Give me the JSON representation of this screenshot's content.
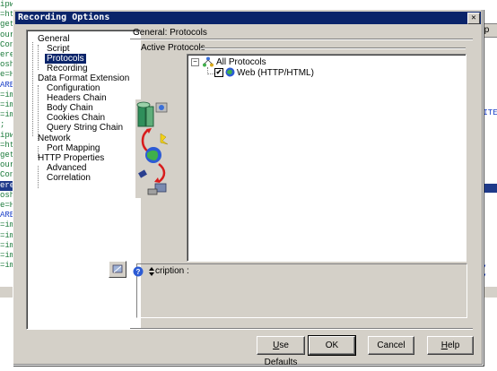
{
  "background": {
    "left_code_lines": [
      "ipw_",
      "=htt",
      "getF",
      "ourc",
      "Cont",
      "erer",
      "osho",
      "e=HT",
      "ARES",
      "=ima",
      "=ima",
      "=ima",
      ";",
      "",
      "ipw_",
      "=htt",
      "getF",
      "ourc",
      "Cont",
      "erer",
      "osho",
      "e=HT",
      "ARES",
      "=ima",
      "=ima",
      "=ima",
      "=ima",
      "=ima"
    ],
    "right_code_lines": [
      "DITE",
      "C",
      "",
      "",
      "",
      "",
      ".",
      "M,",
      "M,"
    ],
    "help_fragment": "elp"
  },
  "dialog": {
    "title": "Recording Options",
    "close_glyph": "✕"
  },
  "tree": {
    "items": [
      {
        "label": "General"
      },
      {
        "label": "Script"
      },
      {
        "label": "Protocols"
      },
      {
        "label": "Recording"
      },
      {
        "label": "Data Format Extension"
      },
      {
        "label": "Configuration"
      },
      {
        "label": "Headers Chain"
      },
      {
        "label": "Body Chain"
      },
      {
        "label": "Cookies Chain"
      },
      {
        "label": "Query String Chain"
      },
      {
        "label": "Network"
      },
      {
        "label": "Port Mapping"
      },
      {
        "label": "HTTP Properties"
      },
      {
        "label": "Advanced"
      },
      {
        "label": "Correlation"
      }
    ],
    "selected": "Protocols"
  },
  "panel": {
    "heading": "General: Protocols",
    "active_protocols_label": "Active Protocols",
    "root_item": "All Protocols",
    "root_expander": "−",
    "child_item": "Web (HTTP/HTML)",
    "child_checked": true,
    "check_glyph": "✔"
  },
  "description": {
    "label": "cription :"
  },
  "buttons": {
    "use_defaults_prefix": "",
    "use_defaults_hotkey": "U",
    "use_defaults_rest": "se Defaults",
    "ok": "OK",
    "cancel": "Cancel",
    "help_hotkey": "H",
    "help_rest": "elp"
  },
  "colors": {
    "titlebar": "#0a246a",
    "dialog_face": "#d4d0c8",
    "selection": "#0a246a"
  }
}
